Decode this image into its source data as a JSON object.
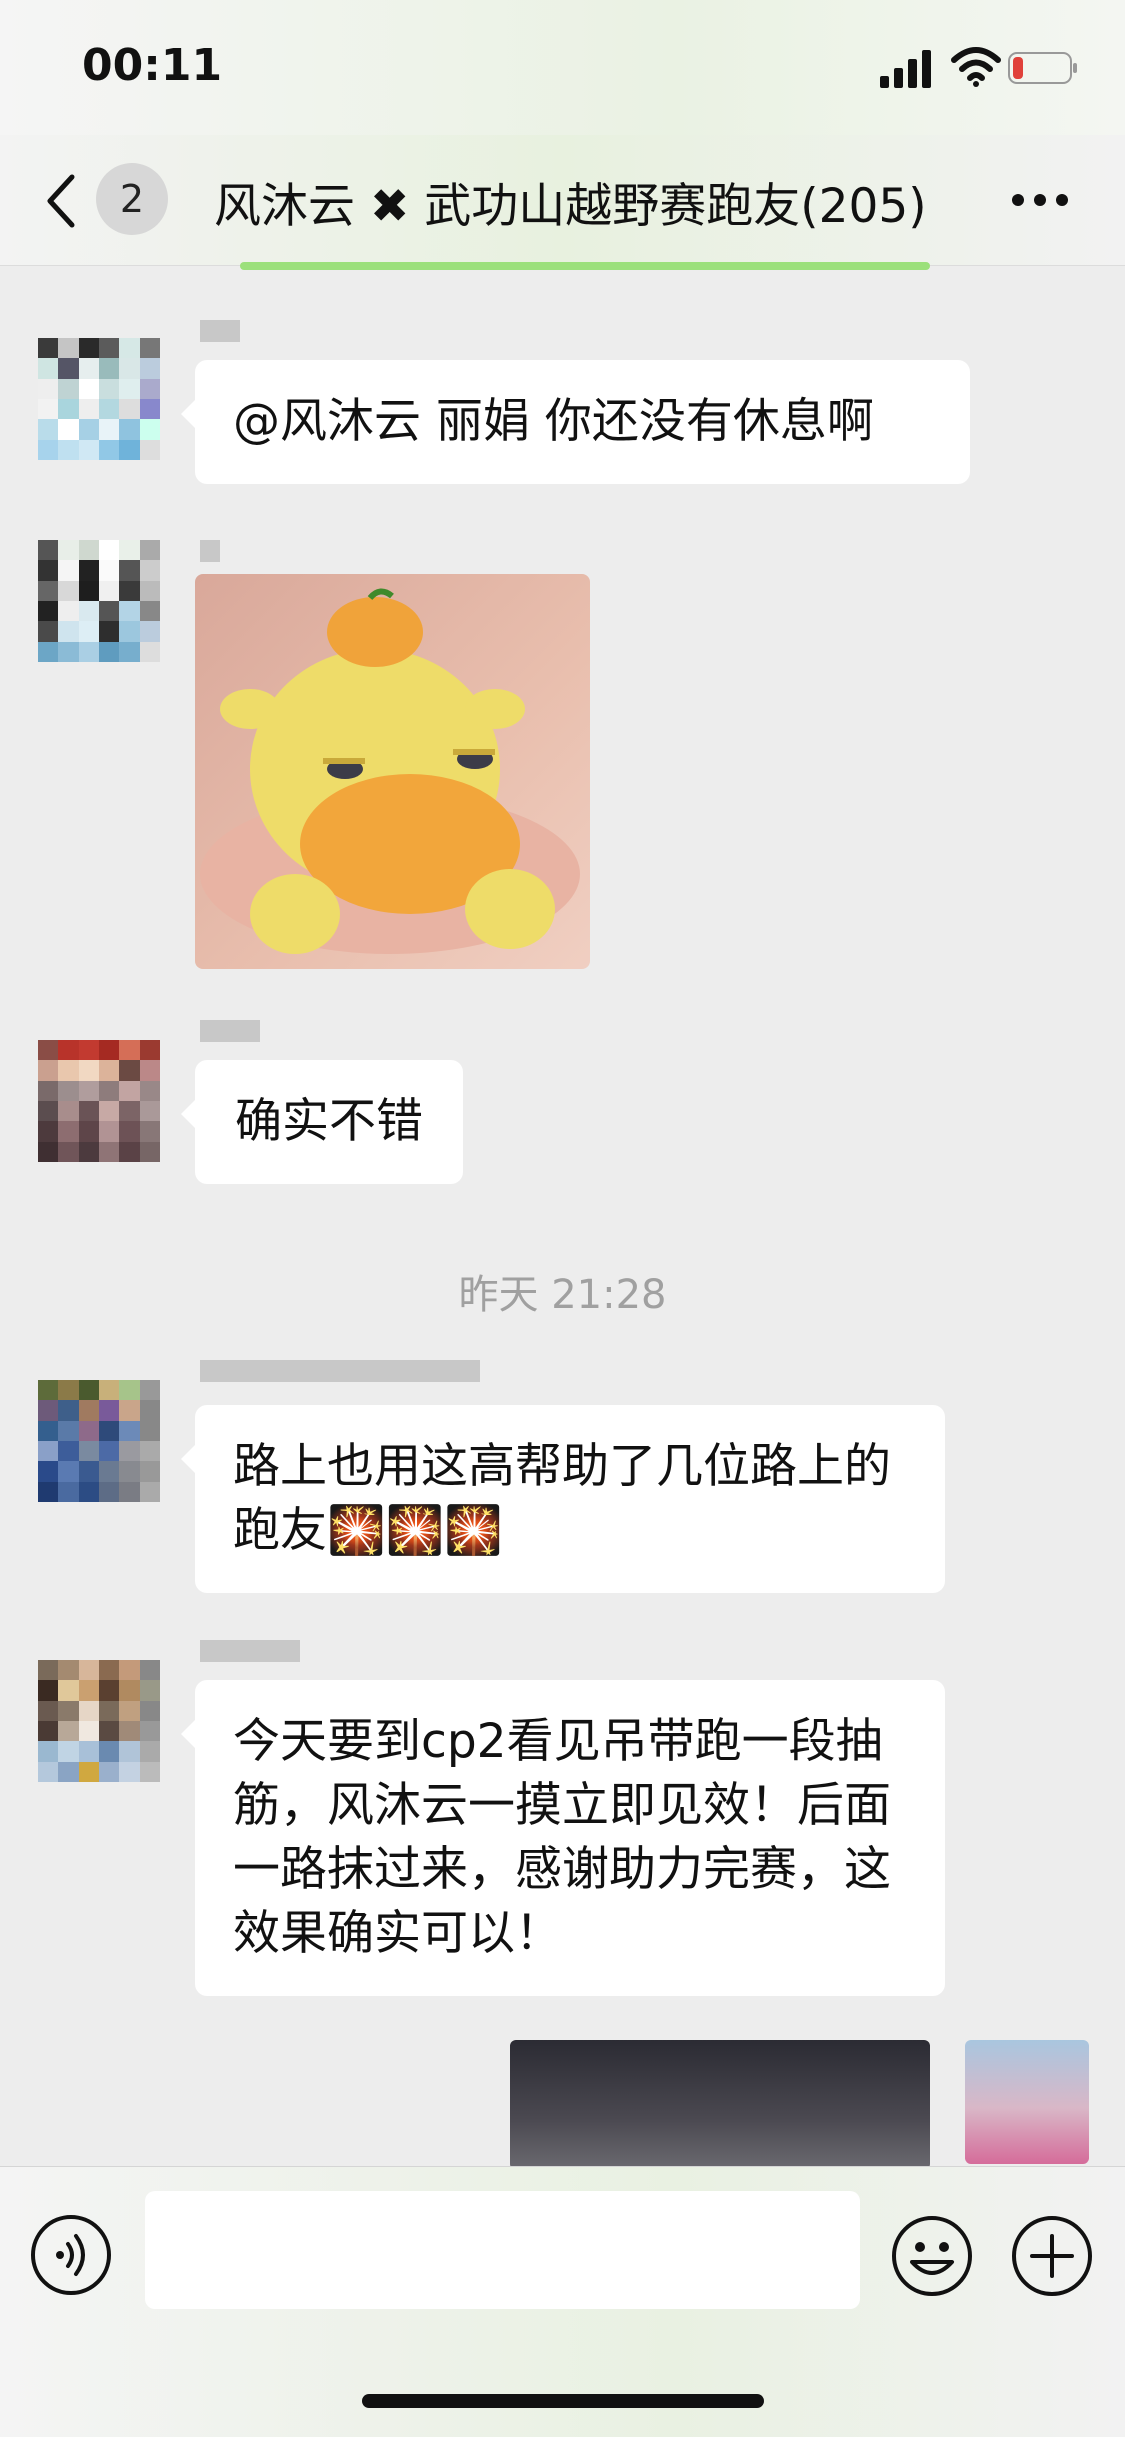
{
  "status_bar": {
    "time": "00:11"
  },
  "nav": {
    "unread_count": "2",
    "title": "风沐云 ✖ 武功山越野赛跑友(205)"
  },
  "messages": [
    {
      "type": "text",
      "text": "@风沐云 丽娟 你还没有休息啊"
    },
    {
      "type": "sticker"
    },
    {
      "type": "text",
      "text": "确实不错"
    },
    {
      "type": "timestamp",
      "text": "昨天 21:28"
    },
    {
      "type": "text",
      "text": "路上也用这高帮助了几位路上的跑友🎇🎇🎇"
    },
    {
      "type": "text",
      "text": "今天要到cp2看见吊带跑一段抽筋，风沐云一摸立即见效！后面一路抹过来，感谢助力完赛，这效果确实可以！"
    }
  ],
  "input": {
    "placeholder": ""
  },
  "icons": [
    "back-arrow-icon",
    "more-icon",
    "voice-icon",
    "emoji-icon",
    "plus-icon",
    "signal-icon",
    "wifi-icon",
    "battery-icon"
  ],
  "colors": {
    "accent_green": "#9be07b",
    "battery_low": "#e0413a"
  }
}
